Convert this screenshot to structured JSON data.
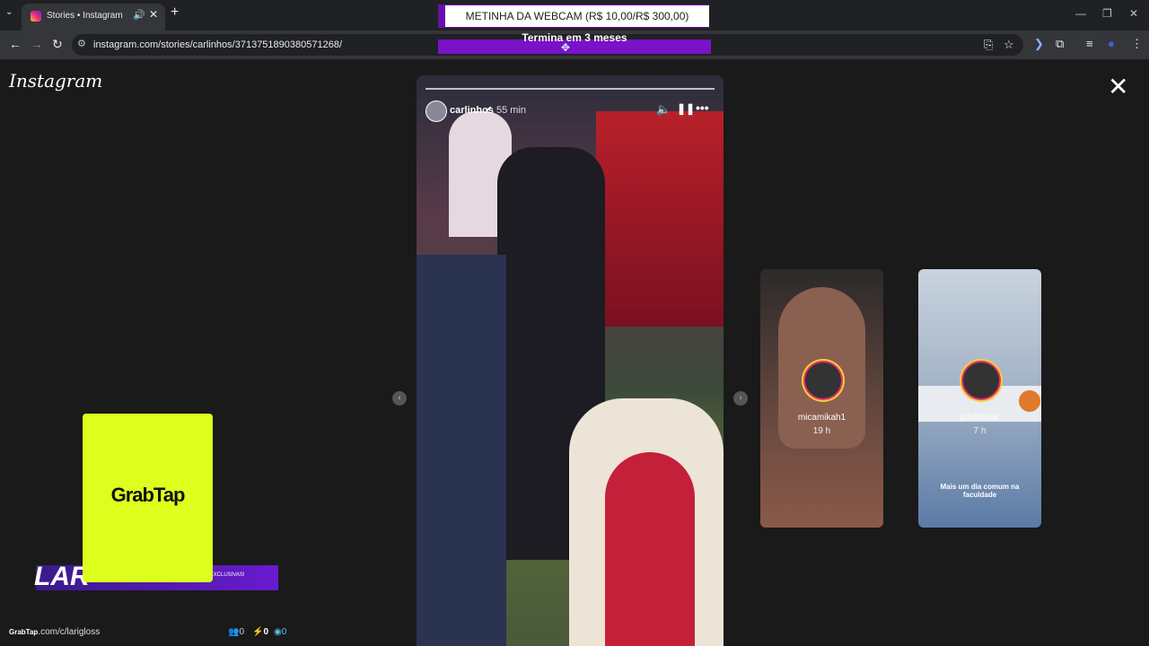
{
  "browser": {
    "tab_title": "Stories • Instagram",
    "url": "instagram.com/stories/carlinhos/3713751890380571268/",
    "tab_list_icon": "chevron-down-icon",
    "new_tab": "+",
    "audio": "🔊",
    "close": "✕"
  },
  "overlay": {
    "goal_title": "METINHA DA WEBCAM (R$ 10,00/R$ 300,00)",
    "goal_end": "Termina em 3 meses"
  },
  "instagram": {
    "logo": "Instagram",
    "close": "✕"
  },
  "story": {
    "user": "carlinhos",
    "time": "55 min"
  },
  "previews": [
    {
      "user": "micamikah1",
      "time": "19 h"
    },
    {
      "user": "p3dr0visk",
      "time": "7 h",
      "caption": "Mais um dia comum na faculdade"
    }
  ],
  "stream": {
    "grabtap": "GrabTap",
    "brand": "GrabTap",
    "url_text": ".com/c/larigloss",
    "lari": "LAR",
    "lari_sub": "S EXCLUSIVAS!",
    "stat1": "0",
    "stat2": "0",
    "stat3": "0"
  }
}
